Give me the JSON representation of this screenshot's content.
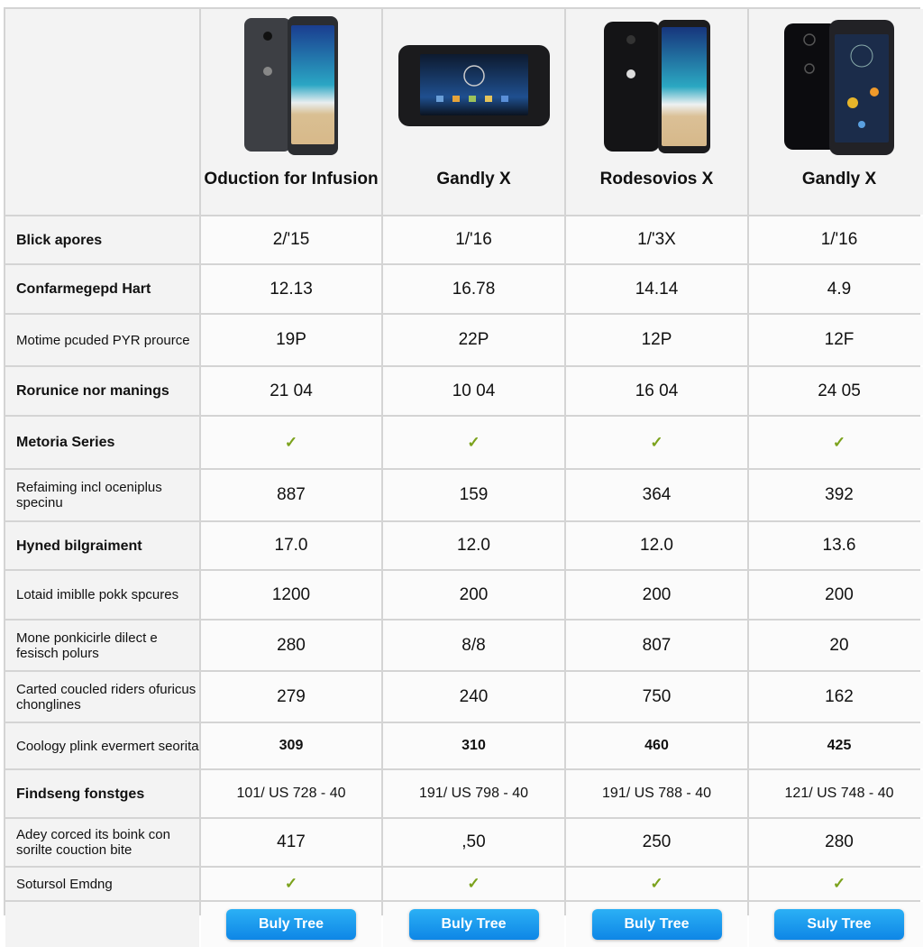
{
  "products": [
    {
      "name": "Oduction for Infusion",
      "image": "phone-pair-gray-icon",
      "button": "Buly Tree"
    },
    {
      "name": "Gandly X",
      "image": "landscape-phone-icon",
      "button": "Buly Tree"
    },
    {
      "name": "Rodesovios X",
      "image": "phone-pair-black-icon",
      "button": "Buly Tree"
    },
    {
      "name": "Gandly X",
      "image": "phone-pair-dark-icon",
      "button": "Suly Tree"
    }
  ],
  "rows": [
    {
      "label": "Blick apores",
      "bold": true,
      "values": [
        "2/'15",
        "1/'16",
        "1/'3X",
        "1/'16"
      ]
    },
    {
      "label": "Confarmegepd Hart",
      "bold": true,
      "values": [
        "12.13",
        "16.78",
        "14.14",
        "4.9"
      ]
    },
    {
      "label": "Motime pcuded PYR prource",
      "bold": false,
      "values": [
        "19P",
        "22P",
        "12P",
        "12F"
      ]
    },
    {
      "label": "Rorunice nor manings",
      "bold": true,
      "values": [
        "21 04",
        "10 04",
        "16 04",
        "24 05"
      ]
    },
    {
      "label": "Metoria Series",
      "bold": true,
      "values": [
        "✓",
        "✓",
        "✓",
        "✓"
      ],
      "check": true
    },
    {
      "label": "Refaiming incl oceniplus specinu",
      "bold": false,
      "values": [
        "887",
        "159",
        "364",
        "392"
      ]
    },
    {
      "label": "Hyned bilgraiment",
      "bold": true,
      "values": [
        "17.0",
        "12.0",
        "12.0",
        "13.6"
      ]
    },
    {
      "label": "Lotaid imiblle pokk spcures",
      "bold": false,
      "values": [
        "1200",
        "200",
        "200",
        "200"
      ]
    },
    {
      "label": "Mone ponkicirle dilect e fesisch polurs",
      "bold": false,
      "values": [
        "280",
        "8/8",
        "807",
        "20"
      ]
    },
    {
      "label": "Carted coucled riders ofuricus chonglines",
      "bold": false,
      "values": [
        "279",
        "240",
        "750",
        "162"
      ]
    },
    {
      "label": "Coology plink evermert seorita",
      "bold": false,
      "values": [
        "309",
        "310",
        "460",
        "425"
      ],
      "small": true
    },
    {
      "label": "Findseng fonstges",
      "bold": true,
      "values": [
        "101/ US 728 - 40",
        "191/ US 798 - 40",
        "191/ US 788 - 40",
        "121/ US 748 - 40"
      ],
      "price": true
    },
    {
      "label": "Adey corced its boink con sorilte couction bite",
      "bold": false,
      "values": [
        "417",
        ",50",
        "250",
        "280"
      ]
    },
    {
      "label": "Sotursol Emdng",
      "bold": false,
      "values": [
        "✓",
        "✓",
        "✓",
        "✓"
      ],
      "check": true
    }
  ],
  "colors": {
    "check": "#7ba21c",
    "button": "#1a9af0",
    "border": "#d4d4d4"
  }
}
